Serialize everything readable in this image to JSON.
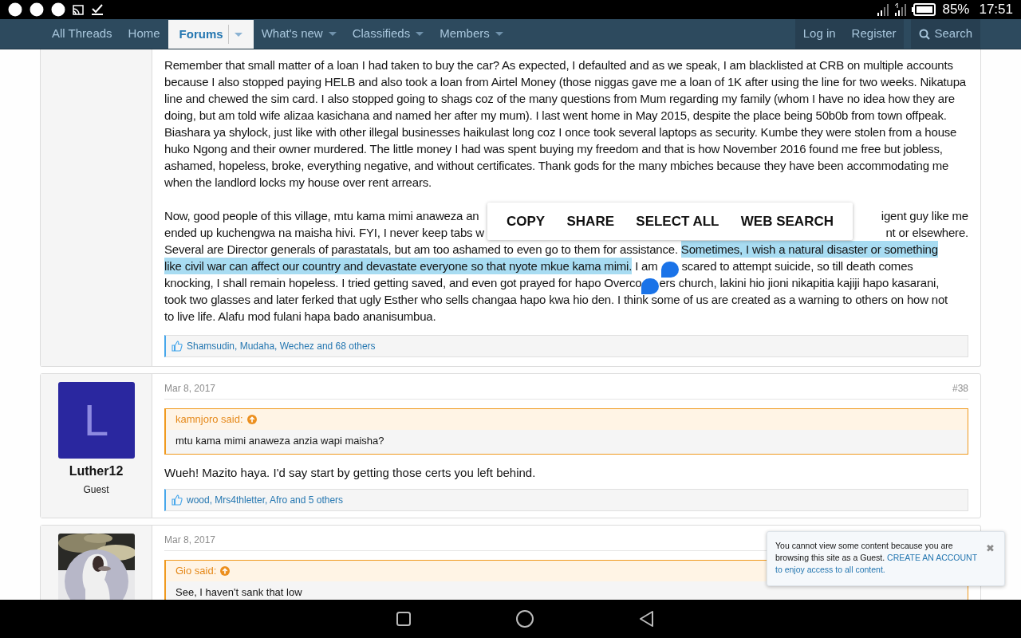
{
  "status_bar": {
    "battery": "85%",
    "time": "17:51"
  },
  "nav": {
    "items": [
      {
        "label": "All Threads",
        "selected": false,
        "dropdown": false
      },
      {
        "label": "Home",
        "selected": false,
        "dropdown": false
      },
      {
        "label": "Forums",
        "selected": true,
        "dropdown": true
      },
      {
        "label": "What's new",
        "selected": false,
        "dropdown": true
      },
      {
        "label": "Classifieds",
        "selected": false,
        "dropdown": true
      },
      {
        "label": "Members",
        "selected": false,
        "dropdown": true
      }
    ],
    "actions": [
      {
        "label": "Log in",
        "kind": "plain"
      },
      {
        "label": "Register",
        "kind": "plain"
      },
      {
        "label": "Search",
        "kind": "search"
      }
    ]
  },
  "posts": [
    {
      "paragraphs": [
        {
          "kind": "text",
          "text": "Remember that small matter of a loan I had taken to buy the car? As expected, I defaulted and as we speak, I am blacklisted at CRB on multiple accounts because I also stopped paying HELB and also took a loan from Airtel Money (those niggas gave me a loan of 1K after using the line for two weeks. Nikatupa line and chewed the sim card. I also stopped going to shags coz of the many questions from Mum regarding my family (whom I have no idea how they are doing, but am told wife alizaa kasichana and named her after my mum). I last went home in May 2015, despite the place being 50b0b from town offpeak. Biashara ya shylock, just like with other illegal businesses haikulast long coz I once took several laptops as security. Kumbe they were stolen from a house huko Ngong and their owner murdered. The little money I had was spent buying my freedom and that is how November 2016 found me free but jobless, ashamed, hopeless, broke, everything negative, and without certificates. Thank gods for the many mbiches because they have been accommodating me when the landlord locks my house over rent arrears."
        },
        {
          "kind": "lines",
          "lines": [
            [
              {
                "kind": "text",
                "text": "Now, good people of this village, mtu kama mimi anaweza an",
                "selected": false
              },
              {
                "kind": "gap"
              },
              {
                "kind": "text",
                "text": "igent guy like me",
                "selected": false
              }
            ],
            [
              {
                "kind": "text",
                "text": "ended up kuchengwa na maisha hivi. FYI, I never keep tabs w",
                "selected": false
              },
              {
                "kind": "gap"
              },
              {
                "kind": "text",
                "text": "nt or elsewhere.",
                "selected": false
              }
            ],
            [
              {
                "kind": "text",
                "text": "Several are Director generals of parastatals, but am too ashamed to even go to them for assistance. ",
                "selected": false
              },
              {
                "kind": "text",
                "text": "Sometimes, I wish a natural disaster or something",
                "selected": true
              }
            ],
            [
              {
                "kind": "text",
                "text": "like civil war can affect our country and devastate everyone so that nyote mkue kama mimi.",
                "selected": true
              },
              {
                "kind": "text",
                "text": " I am ",
                "selected": false
              },
              {
                "kind": "handle"
              },
              {
                "kind": "text",
                "text": " scared to attempt suicide, so till death comes",
                "selected": false
              }
            ],
            [
              {
                "kind": "text",
                "text": "knocking, I shall remain hopeless. I tried getting saved, and even got prayed for hapo Overco",
                "selected": false
              },
              {
                "kind": "handle"
              },
              {
                "kind": "text",
                "text": "ers church, lakini hio jioni nikapitia kajiji hapo kasarani,",
                "selected": false
              }
            ],
            [
              {
                "kind": "text",
                "text": "took two glasses and later ferked that ugly Esther who sells changaa hapo kwa hio den. I think some of us are created as a warning to others on how not",
                "selected": false
              }
            ],
            [
              {
                "kind": "text",
                "text": "to live life. Alafu mod fulani hapa bado ananisumbua.",
                "selected": false
              }
            ]
          ]
        }
      ],
      "reactions": "Shamsudin, Mudaha, Wechez and 68 others"
    },
    {
      "author": {
        "initial": "L",
        "name": "Luther12",
        "role": "Guest",
        "kind": "letter",
        "color": "#2a279f"
      },
      "date": "Mar 8, 2017",
      "number": "#38",
      "quote": {
        "author": "kamnjoro said:",
        "text": "mtu kama mimi anaweza anzia wapi maisha?"
      },
      "body": "Wueh! Mazito haya. I'd say start by getting those certs you left behind.",
      "reactions": "wood, Mrs4thletter, Afro and 5 others"
    },
    {
      "date": "Mar 8, 2017",
      "quote": {
        "author": "Gio said:",
        "text": "See, I haven't sank that low"
      }
    }
  ],
  "selection_menu": [
    "COPY",
    "SHARE",
    "SELECT ALL",
    "WEB SEARCH"
  ],
  "notice": {
    "text": "You cannot view some content because you are browsing this site as a Guest.",
    "link": "CREATE AN ACCOUNT",
    "link_after": "to enjoy access to all content.",
    "close": "✖"
  }
}
